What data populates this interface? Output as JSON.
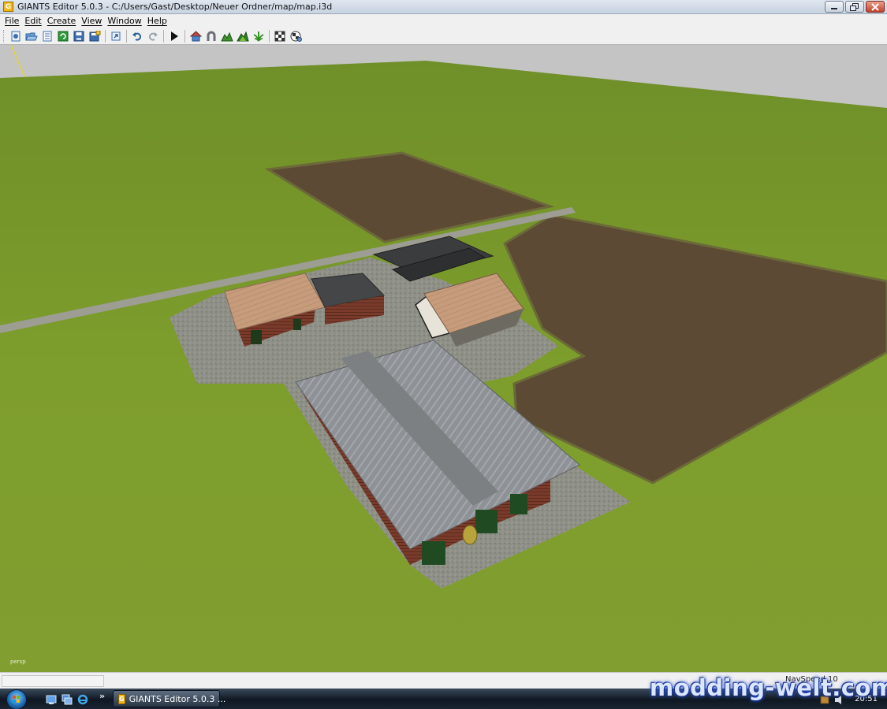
{
  "window": {
    "title": "GIANTS Editor 5.0.3 - C:/Users/Gast/Desktop/Neuer Ordner/map/map.i3d",
    "app_icon_letter": "G",
    "controls": [
      "minimize-icon",
      "maximize-icon",
      "close-icon"
    ]
  },
  "menu": {
    "items": [
      {
        "label": "File"
      },
      {
        "label": "Edit"
      },
      {
        "label": "Create"
      },
      {
        "label": "View"
      },
      {
        "label": "Window"
      },
      {
        "label": "Help"
      }
    ]
  },
  "toolbar": {
    "buttons": [
      {
        "name": "new-scene",
        "icon": "new-file-icon"
      },
      {
        "name": "open",
        "icon": "open-folder-icon"
      },
      {
        "name": "import",
        "icon": "import-icon"
      },
      {
        "name": "reload",
        "icon": "reload-icon"
      },
      {
        "name": "save",
        "icon": "save-icon"
      },
      {
        "name": "save-as",
        "icon": "save-as-icon"
      },
      {
        "name": "export",
        "icon": "export-icon"
      },
      {
        "name": "undo",
        "icon": "undo-icon"
      },
      {
        "name": "redo",
        "icon": "redo-icon"
      },
      {
        "name": "play",
        "icon": "play-icon"
      },
      {
        "name": "select-tool",
        "icon": "house-icon"
      },
      {
        "name": "magnet-tool",
        "icon": "magnet-icon"
      },
      {
        "name": "terrain-tool",
        "icon": "terrain-sculpt-icon"
      },
      {
        "name": "terrain-paint",
        "icon": "terrain-paint-icon"
      },
      {
        "name": "foliage-paint",
        "icon": "foliage-icon"
      },
      {
        "name": "snap-grid",
        "icon": "checker-icon"
      },
      {
        "name": "snap-settings",
        "icon": "checker-gear-icon"
      }
    ]
  },
  "viewport": {
    "camera_label": "persp",
    "colors": {
      "grass": "#7a9b2a",
      "sky": "#c6c6c6",
      "field": "#5e4c36",
      "gravel": "#8d8d8a",
      "road": "#9c9c92",
      "roof_tile": "#c79d7e",
      "roof_metal": "#8e9194",
      "brick": "#7a3a2a"
    }
  },
  "statusbar": {
    "nav_text": "NavSpeed 10"
  },
  "taskbar": {
    "task_label": "GIANTS Editor 5.0.3 ...",
    "overflow_chevron": "»",
    "clock": "20:51"
  },
  "watermark": {
    "text": "modding-welt.com"
  }
}
